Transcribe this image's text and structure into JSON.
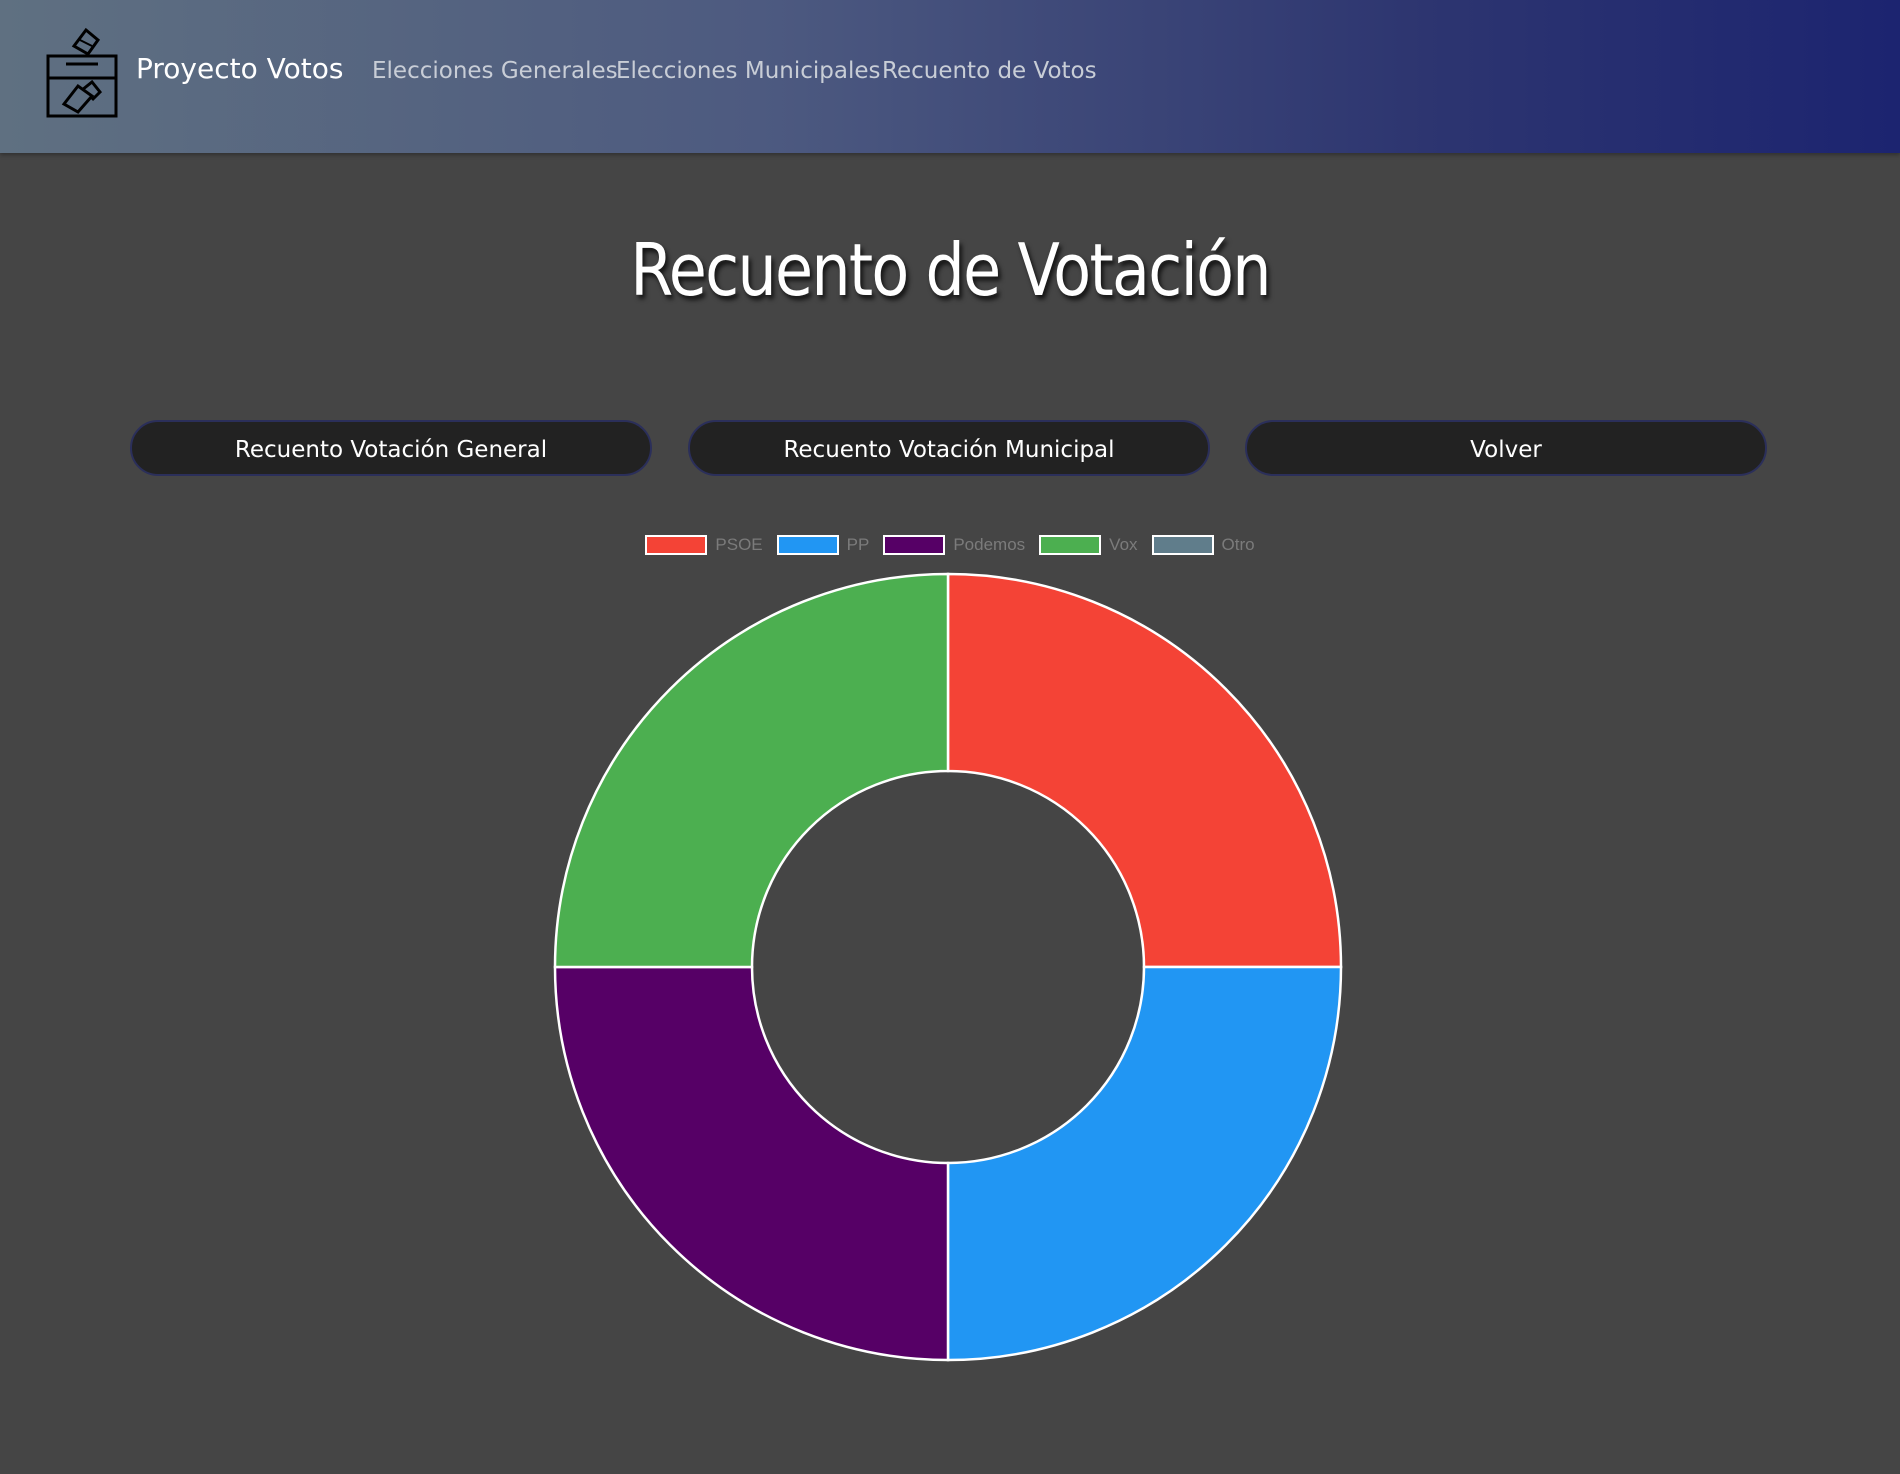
{
  "navbar": {
    "brand": "Proyecto Votos",
    "links": [
      "Elecciones Generales",
      "Elecciones Municipales",
      "Recuento de Votos"
    ]
  },
  "main": {
    "title": "Recuento de Votación",
    "buttons": [
      "Recuento Votación General",
      "Recuento Votación Municipal",
      "Volver"
    ]
  },
  "chart_data": {
    "type": "pie",
    "variant": "doughnut",
    "categories": [
      "PSOE",
      "PP",
      "Podemos",
      "Vox",
      "Otro"
    ],
    "values": [
      1,
      1,
      1,
      1,
      0
    ],
    "colors": [
      "#f44336",
      "#2196f3",
      "#560066",
      "#4caf50",
      "#607d8b"
    ],
    "legend_position": "top"
  }
}
